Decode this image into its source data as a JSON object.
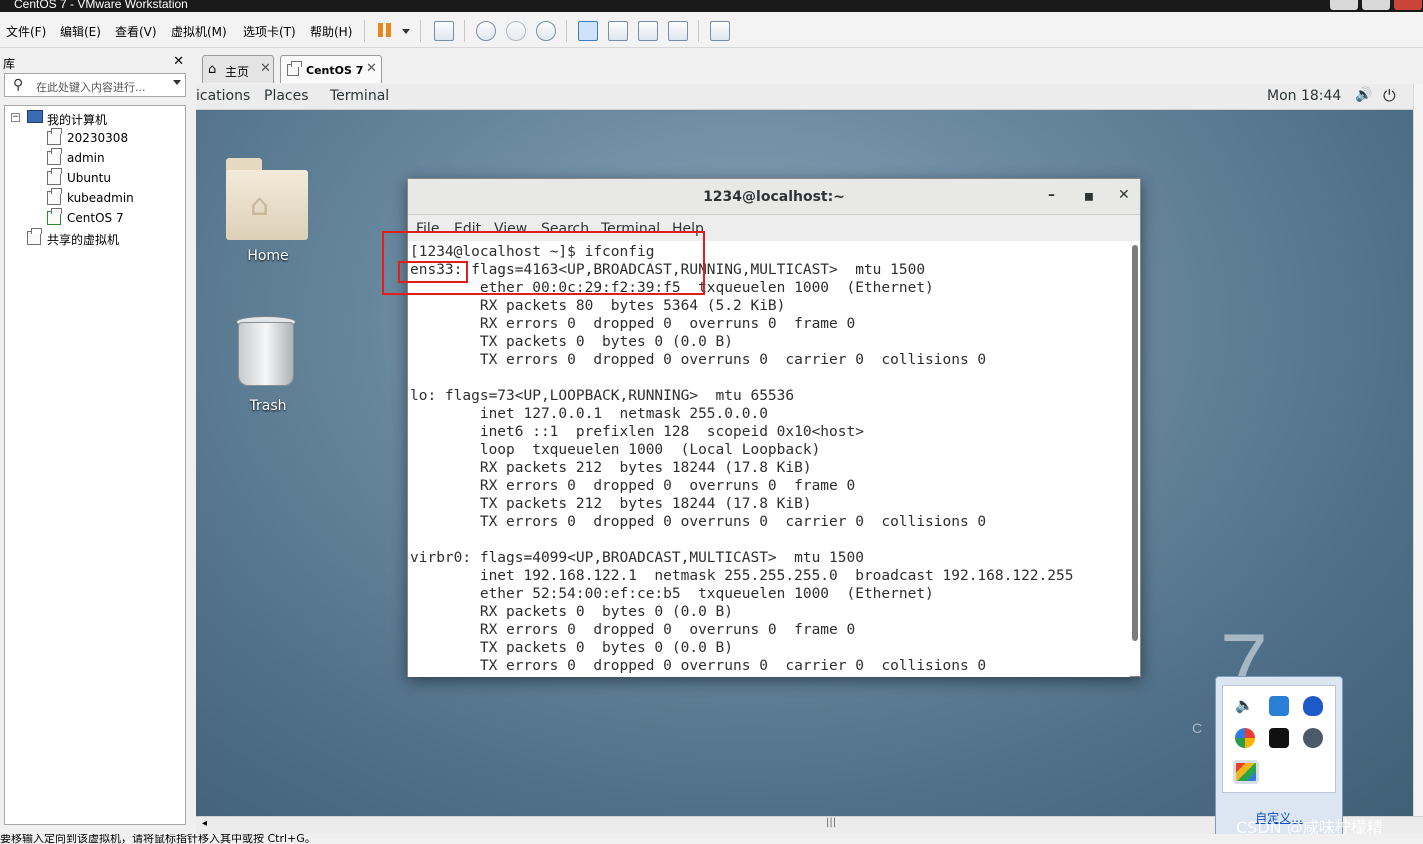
{
  "window": {
    "title": "CentOS 7 - VMware Workstation"
  },
  "menubar": {
    "items": [
      "文件(F)",
      "编辑(E)",
      "查看(V)",
      "虚拟机(M)",
      "选项卡(T)",
      "帮助(H)"
    ]
  },
  "library": {
    "title": "库",
    "close": "✕",
    "search_placeholder": "在此处键入内容进行...",
    "tree": {
      "my_computer": "我的计算机",
      "vms": [
        "20230308",
        "admin",
        "Ubuntu",
        "kubeadmin",
        "CentOS 7"
      ],
      "shared": "共享的虚拟机"
    }
  },
  "tabs": [
    {
      "label": "主页",
      "close": "✕"
    },
    {
      "label": "CentOS 7",
      "close": "✕"
    }
  ],
  "gnome_bar": {
    "applications": "ications",
    "places": "Places",
    "terminal": "Terminal",
    "clock": "Mon 18:44"
  },
  "desktop": {
    "home_label": "Home",
    "trash_label": "Trash",
    "watermark_digit": "7",
    "watermark_text": "C E"
  },
  "terminal": {
    "title": "1234@localhost:~",
    "menu": [
      "File",
      "Edit",
      "View",
      "Search",
      "Terminal",
      "Help"
    ],
    "lines": [
      "[1234@localhost ~]$ ifconfig",
      "ens33: flags=4163<UP,BROADCAST,RUNNING,MULTICAST>  mtu 1500",
      "        ether 00:0c:29:f2:39:f5  txqueuelen 1000  (Ethernet)",
      "        RX packets 80  bytes 5364 (5.2 KiB)",
      "        RX errors 0  dropped 0  overruns 0  frame 0",
      "        TX packets 0  bytes 0 (0.0 B)",
      "        TX errors 0  dropped 0 overruns 0  carrier 0  collisions 0",
      "",
      "lo: flags=73<UP,LOOPBACK,RUNNING>  mtu 65536",
      "        inet 127.0.0.1  netmask 255.0.0.0",
      "        inet6 ::1  prefixlen 128  scopeid 0x10<host>",
      "        loop  txqueuelen 1000  (Local Loopback)",
      "        RX packets 212  bytes 18244 (17.8 KiB)",
      "        RX errors 0  dropped 0  overruns 0  frame 0",
      "        TX packets 212  bytes 18244 (17.8 KiB)",
      "        TX errors 0  dropped 0 overruns 0  carrier 0  collisions 0",
      "",
      "virbr0: flags=4099<UP,BROADCAST,MULTICAST>  mtu 1500",
      "        inet 192.168.122.1  netmask 255.255.255.0  broadcast 192.168.122.255",
      "        ether 52:54:00:ef:ce:b5  txqueuelen 1000  (Ethernet)",
      "        RX packets 0  bytes 0 (0.0 B)",
      "        RX errors 0  dropped 0  overruns 0  frame 0",
      "        TX packets 0  bytes 0 (0.0 B)",
      "        TX errors 0  dropped 0 overruns 0  carrier 0  collisions 0"
    ]
  },
  "tray": {
    "customize": "自定义..."
  },
  "statusbar": {
    "text": "要移输入定向到该虚拟机，请将鼠标指针移入其中或按 Ctrl+G。"
  },
  "watermark": "CSDN @咸味柠檬精",
  "colors": {
    "highlight": "#e01e1e",
    "desktop": "#6a8aa1"
  }
}
